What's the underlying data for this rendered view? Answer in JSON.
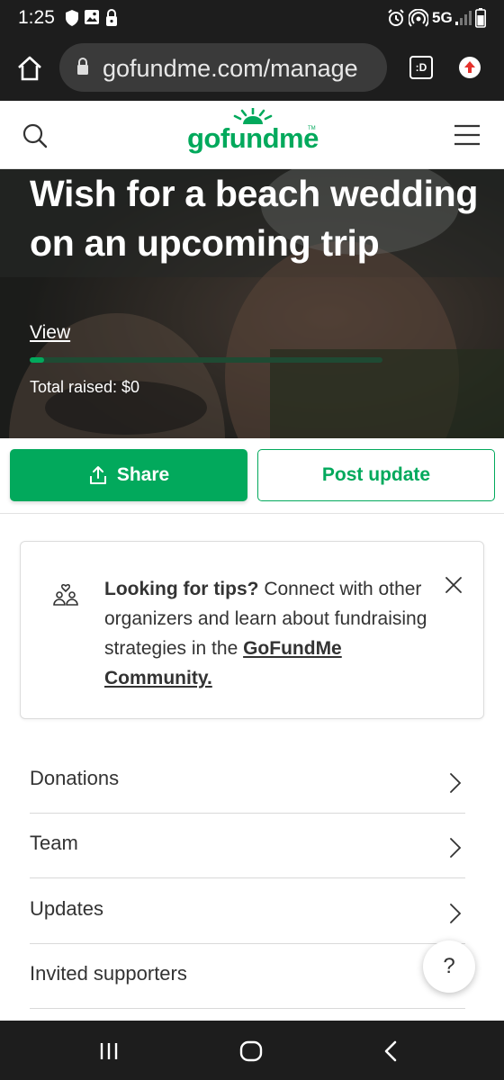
{
  "status_bar": {
    "time": "1:25",
    "network": "5G"
  },
  "browser": {
    "url": "gofundme.com/manage",
    "tab_badge": ":D"
  },
  "header": {
    "logo": "gofundme",
    "logo_tm": "TM"
  },
  "hero": {
    "title": "Wish for a beach wedding on an upcoming trip",
    "view_link": "View",
    "progress_fraction": 0.04,
    "total_raised": "Total raised: $0"
  },
  "actions": {
    "share_label": "Share",
    "post_update_label": "Post update"
  },
  "tips": {
    "heading": "Looking for tips?",
    "body": " Connect with other organizers and learn about fundraising strategies in the ",
    "link": "GoFundMe Community."
  },
  "menu": {
    "items": [
      {
        "label": "Donations"
      },
      {
        "label": "Team"
      },
      {
        "label": "Updates"
      },
      {
        "label": "Invited supporters"
      }
    ]
  },
  "help": {
    "label": "?"
  },
  "colors": {
    "brand": "#02a95c",
    "system_bar": "#1d1d1d"
  }
}
